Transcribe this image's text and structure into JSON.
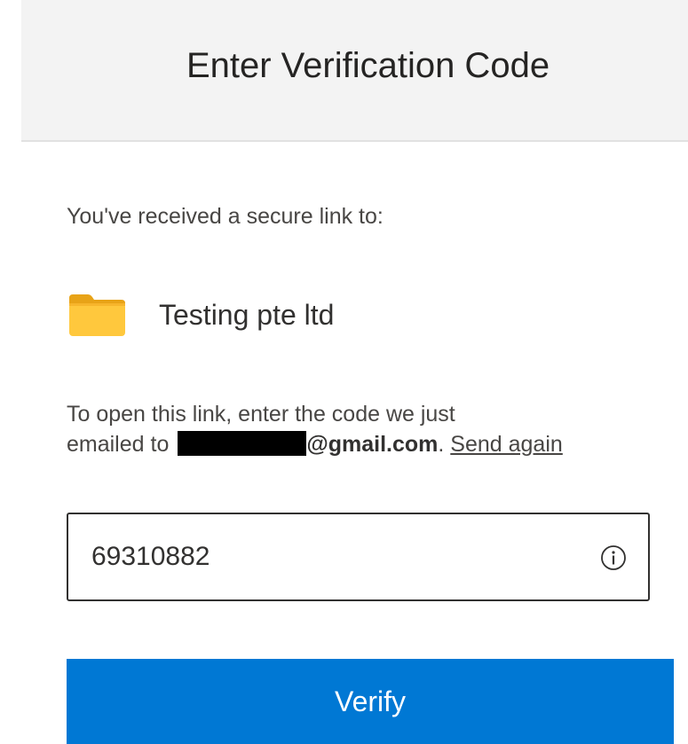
{
  "header": {
    "title": "Enter Verification Code"
  },
  "main": {
    "received_text": "You've received a secure link to:",
    "item": {
      "icon": "folder-icon",
      "name": "Testing pte ltd"
    },
    "instructions": {
      "line1": "To open this link, enter the code we just",
      "prefix": "emailed to",
      "email_domain": "@gmail.com",
      "period": ".",
      "send_again": "Send again"
    },
    "code_field": {
      "value": "69310882",
      "icon": "info-icon"
    },
    "verify_button": {
      "label": "Verify"
    }
  },
  "colors": {
    "accent": "#0078d4",
    "header_bg": "#f3f3f3",
    "folder": "#ffc83d"
  }
}
